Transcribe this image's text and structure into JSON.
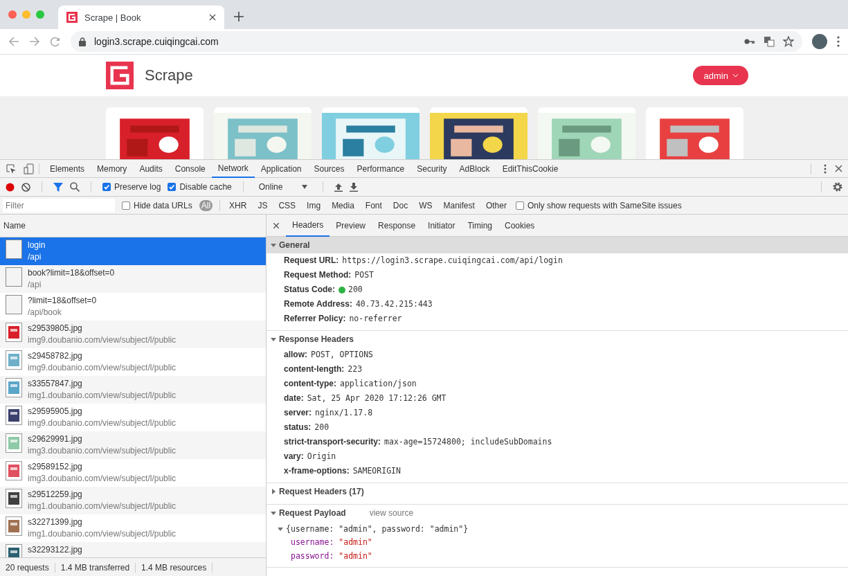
{
  "browser_tab": {
    "title": "Scrape | Book"
  },
  "address_bar": {
    "url": "login3.scrape.cuiqingcai.com"
  },
  "site": {
    "brand": "Scrape",
    "user_menu": "admin"
  },
  "devtools": {
    "tabs": [
      {
        "label": "Elements",
        "selected": false
      },
      {
        "label": "Memory",
        "selected": false
      },
      {
        "label": "Audits",
        "selected": false
      },
      {
        "label": "Console",
        "selected": false
      },
      {
        "label": "Network",
        "selected": true
      },
      {
        "label": "Application",
        "selected": false
      },
      {
        "label": "Sources",
        "selected": false
      },
      {
        "label": "Performance",
        "selected": false
      },
      {
        "label": "Security",
        "selected": false
      },
      {
        "label": "AdBlock",
        "selected": false
      },
      {
        "label": "EditThisCookie",
        "selected": false
      }
    ],
    "toolbar": {
      "preserve_log": {
        "label": "Preserve log",
        "checked": true
      },
      "disable_cache": {
        "label": "Disable cache",
        "checked": true
      },
      "throttling": "Online"
    },
    "filter_bar": {
      "placeholder": "Filter",
      "hide_data_urls": {
        "label": "Hide data URLs",
        "checked": false
      },
      "types": [
        {
          "label": "All",
          "selected": true
        },
        {
          "label": "XHR",
          "selected": false
        },
        {
          "label": "JS",
          "selected": false
        },
        {
          "label": "CSS",
          "selected": false
        },
        {
          "label": "Img",
          "selected": false
        },
        {
          "label": "Media",
          "selected": false
        },
        {
          "label": "Font",
          "selected": false
        },
        {
          "label": "Doc",
          "selected": false
        },
        {
          "label": "WS",
          "selected": false
        },
        {
          "label": "Manifest",
          "selected": false
        },
        {
          "label": "Other",
          "selected": false
        }
      ],
      "samesite": {
        "label": "Only show requests with SameSite issues",
        "checked": false
      }
    },
    "requests": {
      "column": "Name",
      "rows": [
        {
          "name": "login",
          "path": "/api",
          "kind": "doc",
          "selected": true
        },
        {
          "name": "book?limit=18&offset=0",
          "path": "/api",
          "kind": "doc",
          "selected": false
        },
        {
          "name": "?limit=18&offset=0",
          "path": "/api/book",
          "kind": "doc",
          "selected": false
        },
        {
          "name": "s29539805.jpg",
          "path": "img9.doubanio.com/view/subject/l/public",
          "color": "#d8202a",
          "selected": false
        },
        {
          "name": "s29458782.jpg",
          "path": "img9.doubanio.com/view/subject/l/public",
          "color": "#6fb0c8",
          "selected": false
        },
        {
          "name": "s33557847.jpg",
          "path": "img1.doubanio.com/view/subject/l/public",
          "color": "#5aa6c9",
          "selected": false
        },
        {
          "name": "s29595905.jpg",
          "path": "img9.doubanio.com/view/subject/l/public",
          "color": "#3a3f6e",
          "selected": false
        },
        {
          "name": "s29629991.jpg",
          "path": "img3.doubanio.com/view/subject/l/public",
          "color": "#8fcaa8",
          "selected": false
        },
        {
          "name": "s29589152.jpg",
          "path": "img3.doubanio.com/view/subject/l/public",
          "color": "#e05060",
          "selected": false
        },
        {
          "name": "s29512259.jpg",
          "path": "img1.doubanio.com/view/subject/l/public",
          "color": "#404040",
          "selected": false
        },
        {
          "name": "s32271399.jpg",
          "path": "img1.doubanio.com/view/subject/l/public",
          "color": "#a07050",
          "selected": false
        },
        {
          "name": "s32293122.jpg",
          "color": "#2a6070",
          "selected": false
        }
      ],
      "status": [
        "20 requests",
        "1.4 MB transferred",
        "1.4 MB resources"
      ]
    },
    "detail_tabs": [
      {
        "label": "Headers",
        "selected": true
      },
      {
        "label": "Preview",
        "selected": false
      },
      {
        "label": "Response",
        "selected": false
      },
      {
        "label": "Initiator",
        "selected": false
      },
      {
        "label": "Timing",
        "selected": false
      },
      {
        "label": "Cookies",
        "selected": false
      }
    ],
    "sections": [
      {
        "title": "General",
        "expanded": true,
        "highlighted": true,
        "fields": [
          {
            "key": "Request URL:",
            "value": "https://login3.scrape.cuiqingcai.com/api/login"
          },
          {
            "key": "Request Method:",
            "value": "POST"
          },
          {
            "key": "Status Code:",
            "value": "200",
            "color": "#2fb344"
          },
          {
            "key": "Remote Address:",
            "value": "40.73.42.215:443"
          },
          {
            "key": "Referrer Policy:",
            "value": "no-referrer"
          }
        ]
      },
      {
        "title": "Response Headers",
        "expanded": true,
        "highlighted": false,
        "fields": [
          {
            "key": "allow:",
            "value": "POST, OPTIONS"
          },
          {
            "key": "content-length:",
            "value": "223"
          },
          {
            "key": "content-type:",
            "value": "application/json"
          },
          {
            "key": "date:",
            "value": "Sat, 25 Apr 2020 17:12:26 GMT"
          },
          {
            "key": "server:",
            "value": "nginx/1.17.8"
          },
          {
            "key": "status:",
            "value": "200"
          },
          {
            "key": "strict-transport-security:",
            "value": "max-age=15724800; includeSubDomains"
          },
          {
            "key": "vary:",
            "value": "Origin"
          },
          {
            "key": "x-frame-options:",
            "value": "SAMEORIGIN"
          }
        ]
      },
      {
        "title": "Request Headers (17)",
        "expanded": false,
        "highlighted": false
      }
    ],
    "payload": {
      "title": "Request Payload",
      "link": "view source",
      "summary": "{username: \"admin\", password: \"admin\"}",
      "expanded": true,
      "fields": [
        {
          "key": "username:",
          "value": "\"admin\""
        },
        {
          "key": "password:",
          "value": "\"admin\""
        }
      ]
    }
  }
}
